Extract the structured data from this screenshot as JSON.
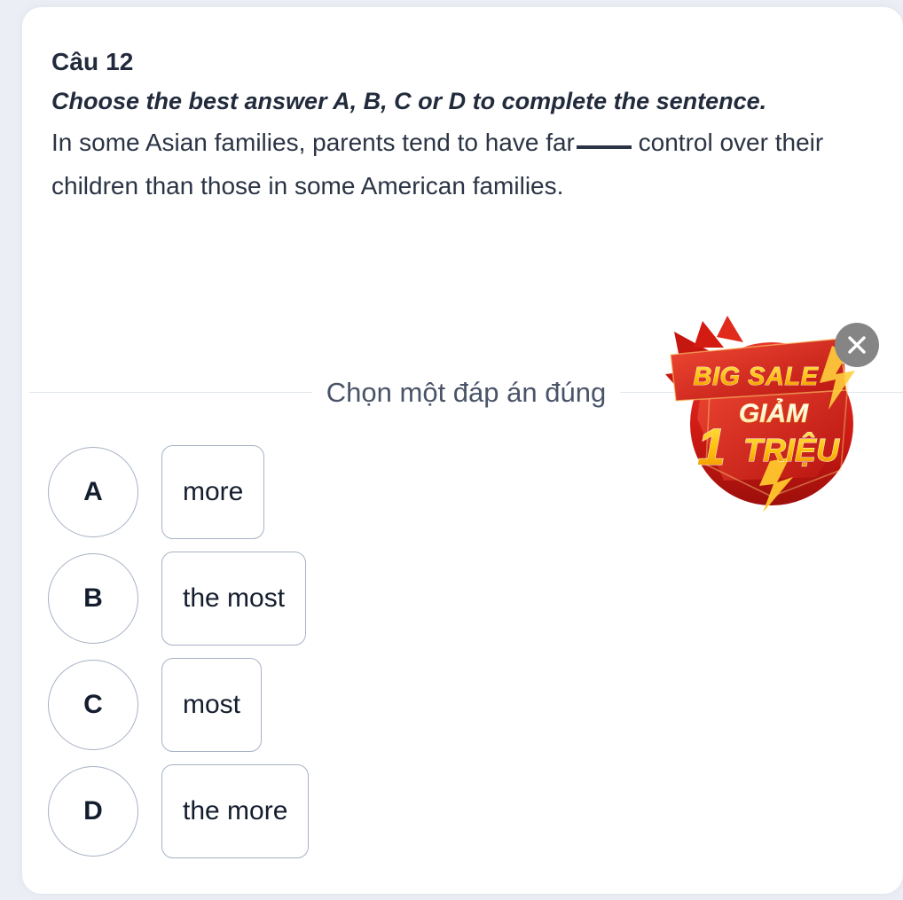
{
  "question": {
    "number_label": "Câu 12",
    "instruction": "Choose the best answer A, B, C or D to complete the sentence.",
    "sentence_part1": "In some Asian families, parents tend to have far",
    "sentence_part2": "control over their children than those in some American families."
  },
  "prompt": {
    "text": "Chọn một đáp án đúng"
  },
  "options": [
    {
      "letter": "A",
      "text": "more"
    },
    {
      "letter": "B",
      "text": "the most"
    },
    {
      "letter": "C",
      "text": "most"
    },
    {
      "letter": "D",
      "text": "the more"
    }
  ],
  "ad": {
    "line1": "BIG SALE",
    "line2": "GIẢM",
    "amount_number": "1",
    "amount_unit": "TRIỆU",
    "close_icon": "close-icon"
  },
  "colors": {
    "page_background": "#eceef5",
    "card_background": "#ffffff",
    "text_primary": "#222b3c",
    "text_prompt": "#4a5468",
    "option_border": "#a7b2c4",
    "divider": "#e2e6ef",
    "ad_red": "#d8241d",
    "ad_red_dark": "#a8140f",
    "ad_yellow": "#ffc60b",
    "ad_cream": "#fff6e0",
    "ad_close_bg": "#858585"
  }
}
